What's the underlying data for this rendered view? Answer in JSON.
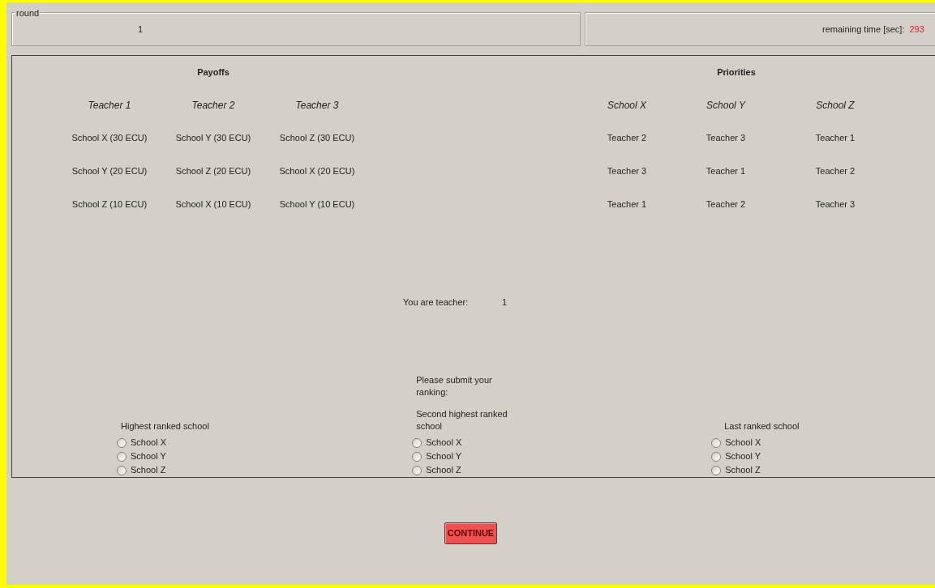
{
  "round": {
    "legend": "round",
    "value": "1"
  },
  "timer": {
    "label": "remaining time [sec]:",
    "value": "293"
  },
  "payoffs": {
    "title": "Payoffs",
    "columns": [
      {
        "header": "Teacher 1",
        "items": [
          "School X (30 ECU)",
          "School Y (20 ECU)",
          "School Z (10 ECU)"
        ]
      },
      {
        "header": "Teacher 2",
        "items": [
          "School Y (30 ECU)",
          "School Z (20 ECU)",
          "School X (10 ECU)"
        ]
      },
      {
        "header": "Teacher 3",
        "items": [
          "School Z (30 ECU)",
          "School X (20 ECU)",
          "School Y (10 ECU)"
        ]
      }
    ]
  },
  "priorities": {
    "title": "Priorities",
    "columns": [
      {
        "header": "School X",
        "items": [
          "Teacher 2",
          "Teacher 3",
          "Teacher 1"
        ]
      },
      {
        "header": "School Y",
        "items": [
          "Teacher 3",
          "Teacher 1",
          "Teacher 2"
        ]
      },
      {
        "header": "School Z",
        "items": [
          "Teacher 1",
          "Teacher 2",
          "Teacher 3"
        ]
      }
    ]
  },
  "identity": {
    "label": "You are teacher:",
    "value": "1"
  },
  "rankings": [
    {
      "label": "Highest ranked school",
      "options": [
        {
          "label": "School X",
          "selected": false
        },
        {
          "label": "School Y",
          "selected": false
        },
        {
          "label": "School Z",
          "selected": false
        }
      ]
    },
    {
      "prompt": "Please submit your ranking:",
      "label": "Second highest ranked school",
      "options": [
        {
          "label": "School X",
          "selected": false
        },
        {
          "label": "School Y",
          "selected": false
        },
        {
          "label": "School Z",
          "selected": false
        }
      ]
    },
    {
      "label": "Last ranked school",
      "options": [
        {
          "label": "School X",
          "selected": false
        },
        {
          "label": "School Y",
          "selected": false
        },
        {
          "label": "School Z",
          "selected": false
        }
      ]
    }
  ],
  "continue_button": "CONTINUE"
}
